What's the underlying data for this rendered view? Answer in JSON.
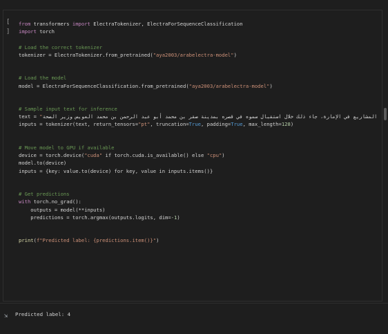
{
  "cell": {
    "run_gutter": "[ ]",
    "lines": [
      {
        "segments": [
          {
            "t": "from",
            "c": "kw"
          },
          {
            "t": " transformers ",
            "c": "plain"
          },
          {
            "t": "import",
            "c": "kw"
          },
          {
            "t": " ElectraTokenizer, ElectraForSequenceClassification",
            "c": "plain"
          }
        ]
      },
      {
        "segments": [
          {
            "t": "import",
            "c": "kw"
          },
          {
            "t": " torch",
            "c": "plain"
          }
        ]
      },
      {
        "segments": []
      },
      {
        "segments": [
          {
            "t": "# Load the correct tokenizer",
            "c": "cm"
          }
        ]
      },
      {
        "segments": [
          {
            "t": "tokenizer = ElectraTokenizer.from_pretrained(",
            "c": "plain"
          },
          {
            "t": "\"aya2003/arabelectra-model\"",
            "c": "str"
          },
          {
            "t": ")",
            "c": "plain"
          }
        ]
      },
      {
        "segments": []
      },
      {
        "segments": []
      },
      {
        "segments": [
          {
            "t": "# Load the model",
            "c": "cm"
          }
        ]
      },
      {
        "segments": [
          {
            "t": "model = ElectraForSequenceClassification.from_pretrained(",
            "c": "plain"
          },
          {
            "t": "\"aya2003/arabelectra-model\"",
            "c": "str"
          },
          {
            "t": ")",
            "c": "plain"
          }
        ]
      },
      {
        "segments": []
      },
      {
        "segments": []
      },
      {
        "segments": [
          {
            "t": "# Sample input text for inference",
            "c": "cm"
          }
        ]
      },
      {
        "segments": [
          {
            "t": "text = ",
            "c": "plain"
          },
          {
            "t": "\"",
            "c": "str"
          },
          {
            "t": "تمث المستقبلية والحالية، والتي تتضمن تنفيذ عدد من المشاريع في الإمارة، جاء ذلك خلال استقبال سموه في قصره بمدينة صقر بن محمد أبو عبد الرحمن بن محمد العويس وزير الصحة",
            "c": "rtl"
          },
          {
            "t": "\"",
            "c": "str"
          }
        ]
      },
      {
        "segments": [
          {
            "t": "inputs = tokenizer(text, return_tensors=",
            "c": "plain"
          },
          {
            "t": "\"pt\"",
            "c": "str"
          },
          {
            "t": ", truncation=",
            "c": "plain"
          },
          {
            "t": "True",
            "c": "kc"
          },
          {
            "t": ", padding=",
            "c": "plain"
          },
          {
            "t": "True",
            "c": "kc"
          },
          {
            "t": ", max_length=",
            "c": "plain"
          },
          {
            "t": "128",
            "c": "num"
          },
          {
            "t": ")",
            "c": "plain"
          }
        ]
      },
      {
        "segments": []
      },
      {
        "segments": []
      },
      {
        "segments": [
          {
            "t": "# Move model to GPU if available",
            "c": "cm"
          }
        ]
      },
      {
        "segments": [
          {
            "t": "device = torch.device(",
            "c": "plain"
          },
          {
            "t": "\"cuda\"",
            "c": "str"
          },
          {
            "t": " if torch.cuda.is_available() else ",
            "c": "plain"
          },
          {
            "t": "\"cpu\"",
            "c": "str"
          },
          {
            "t": ")",
            "c": "plain"
          }
        ]
      },
      {
        "segments": [
          {
            "t": "model.to(device)",
            "c": "plain"
          }
        ]
      },
      {
        "segments": [
          {
            "t": "inputs = {key: value.to(device) for key, value in inputs.items()}",
            "c": "plain"
          }
        ]
      },
      {
        "segments": []
      },
      {
        "segments": []
      },
      {
        "segments": [
          {
            "t": "# Get predictions",
            "c": "cm"
          }
        ]
      },
      {
        "segments": [
          {
            "t": "with",
            "c": "kw"
          },
          {
            "t": " torch.no_grad():",
            "c": "plain"
          }
        ]
      },
      {
        "segments": [
          {
            "t": "    outputs = model(**inputs)",
            "c": "plain"
          }
        ]
      },
      {
        "segments": [
          {
            "t": "    predictions = torch.argmax(outputs.logits, dim=",
            "c": "plain"
          },
          {
            "t": "-1",
            "c": "num"
          },
          {
            "t": ")",
            "c": "plain"
          }
        ]
      },
      {
        "segments": []
      },
      {
        "segments": []
      },
      {
        "segments": [
          {
            "t": "print",
            "c": "bi"
          },
          {
            "t": "(",
            "c": "plain"
          },
          {
            "t": "f\"Predicted label: {predictions.item()}\"",
            "c": "str"
          },
          {
            "t": ")",
            "c": "plain"
          }
        ]
      }
    ]
  },
  "output": {
    "icon": "output-icon",
    "text": "Predicted label: 4"
  }
}
